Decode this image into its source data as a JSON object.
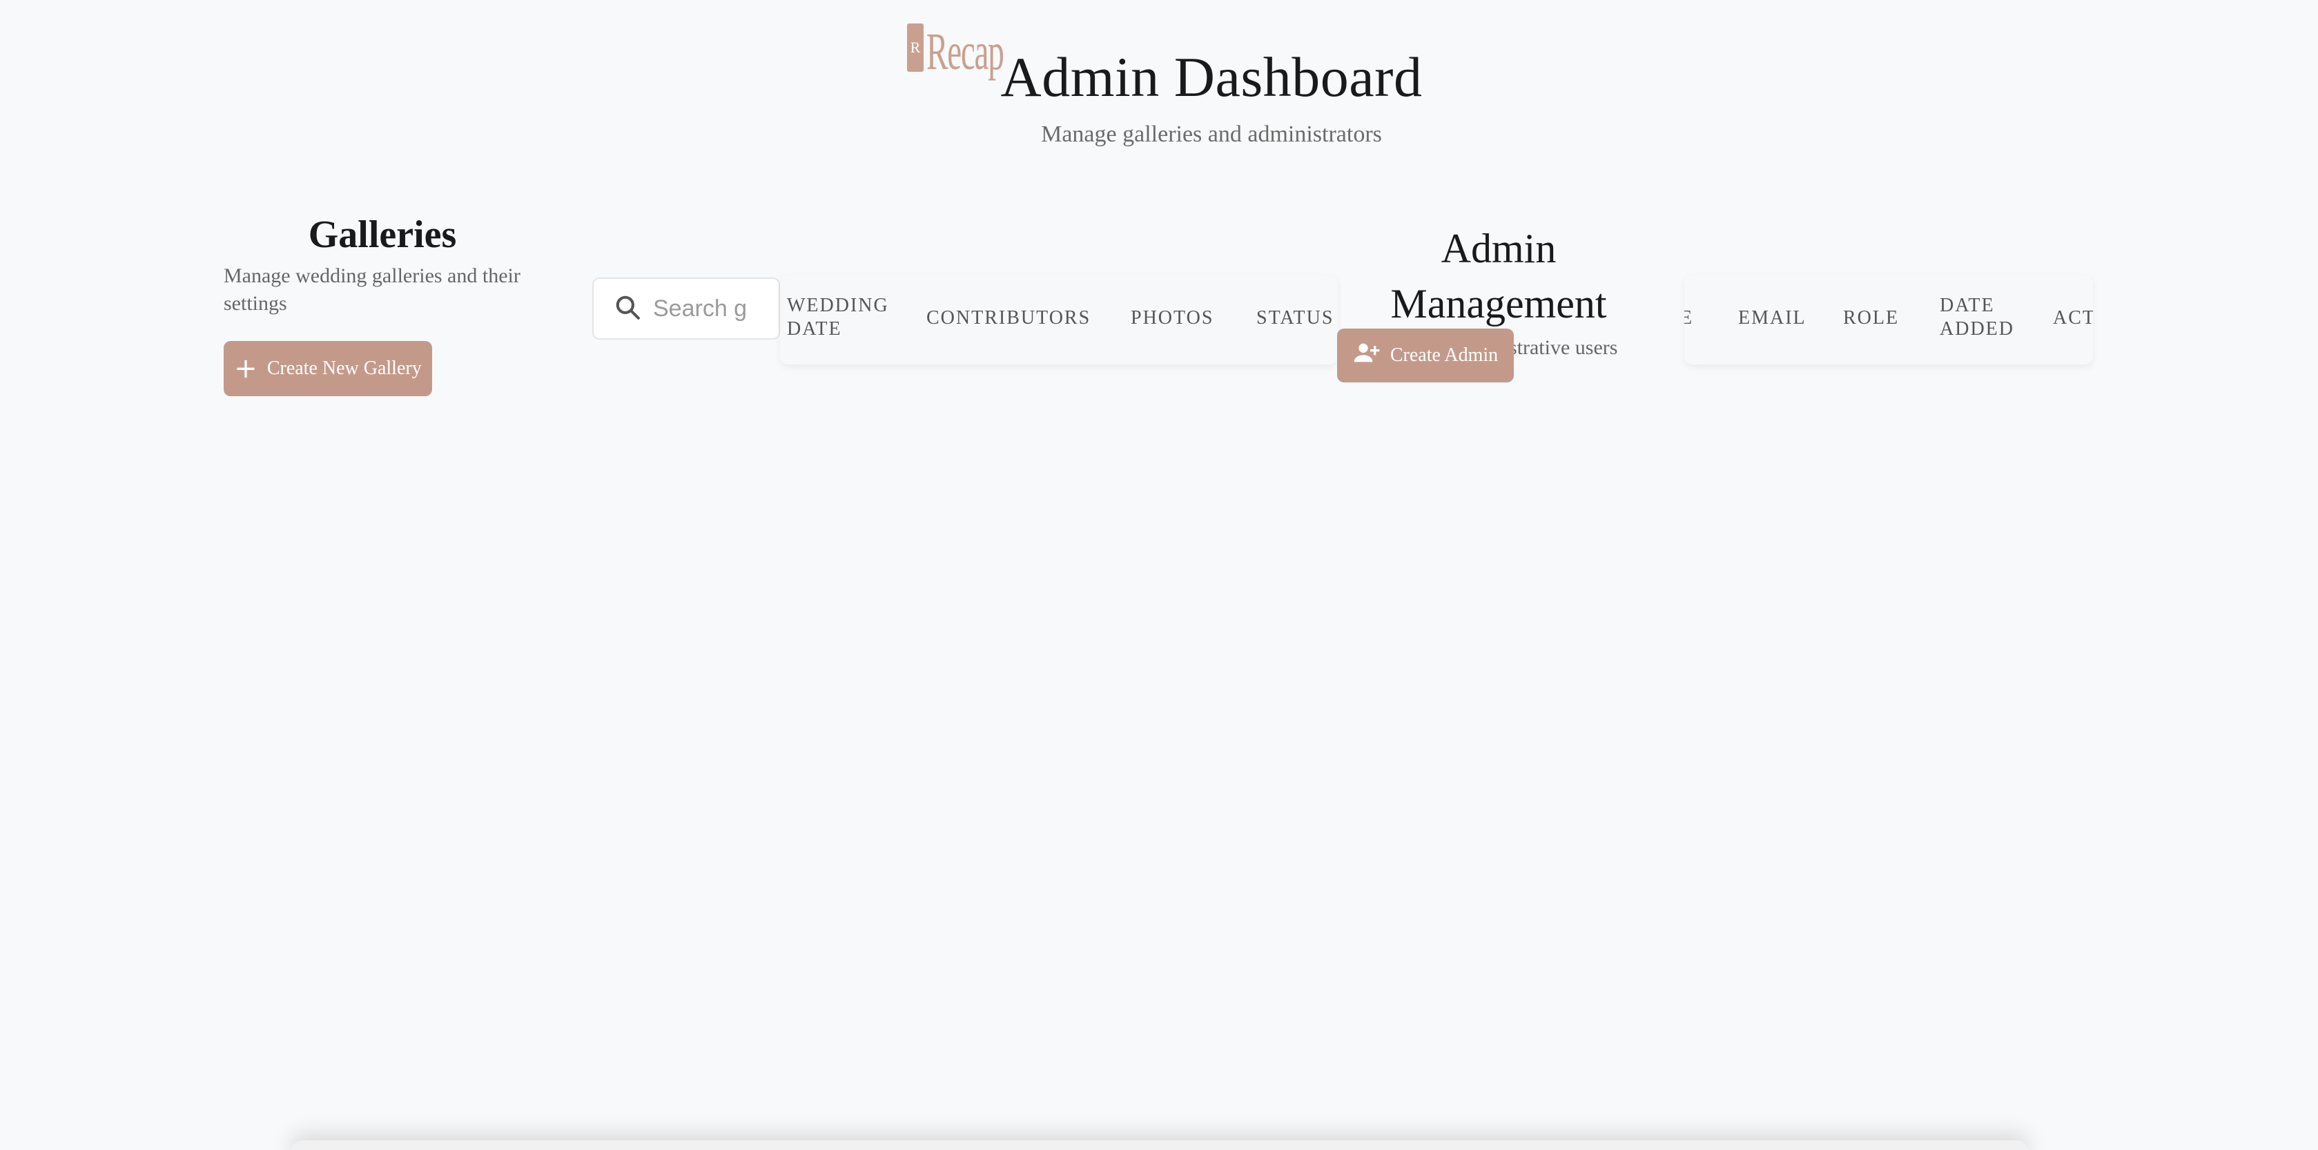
{
  "header": {
    "logo_mark": "R",
    "logo_word": "Recap",
    "title": "Admin Dashboard",
    "subtitle": "Manage galleries and administrators"
  },
  "galleries": {
    "title": "Galleries",
    "description": "Manage wedding galleries and their settings",
    "create_label": "Create New Gallery",
    "search_placeholder": "Search g",
    "columns": [
      "WEDDING DATE",
      "CONTRIBUTORS",
      "PHOTOS",
      "STATUS"
    ]
  },
  "admins": {
    "title": "Admin Management",
    "description": "Manage administrative users",
    "create_label": "Create Admin",
    "columns": [
      "E",
      "EMAIL",
      "ROLE",
      "DATE ADDED",
      "ACT"
    ]
  },
  "colors": {
    "accent": "#c39a8a",
    "background": "#f8f9fa"
  }
}
